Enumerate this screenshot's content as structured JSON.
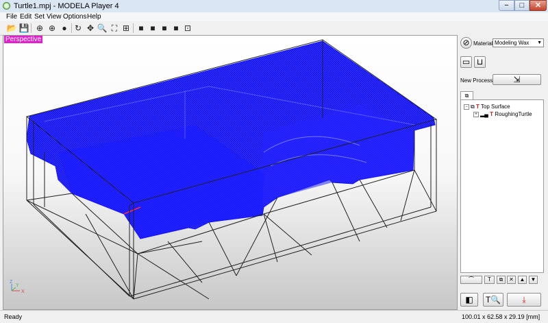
{
  "window": {
    "title": "Turtle1.mpj - MODELA Player 4",
    "min": "−",
    "max": "□",
    "close": "✕"
  },
  "menu": [
    "File",
    "Edit",
    "Set",
    "View",
    "Options",
    "Help"
  ],
  "toolbar": {
    "open": "📂",
    "save": "💾",
    "view_a": "⊕",
    "view_b": "⊕",
    "view_c": "●",
    "rotate": "↻",
    "pan": "✥",
    "zoom": "🔍",
    "fit": "⛶",
    "zoom_window": "⊞",
    "view_front": "■",
    "view_right": "■",
    "view_left": "■",
    "view_top": "■",
    "view_iso": "⊡"
  },
  "viewport": {
    "mode_label": "Perspective",
    "axis_x": "X",
    "axis_y": "Y",
    "axis_z": "Z"
  },
  "side": {
    "material_label": "Material",
    "material_value": "Modeling Wax",
    "new_process_label": "New Process",
    "tree": {
      "top_surface": "Top Surface",
      "roughing": "RoughingTurtle"
    }
  },
  "status": {
    "left": "Ready",
    "right": "100.01 x 62.58 x 29.19 [mm]"
  },
  "colors": {
    "toolpath": "#1010ff",
    "badge": "#e020c8",
    "wire": "#202020"
  }
}
